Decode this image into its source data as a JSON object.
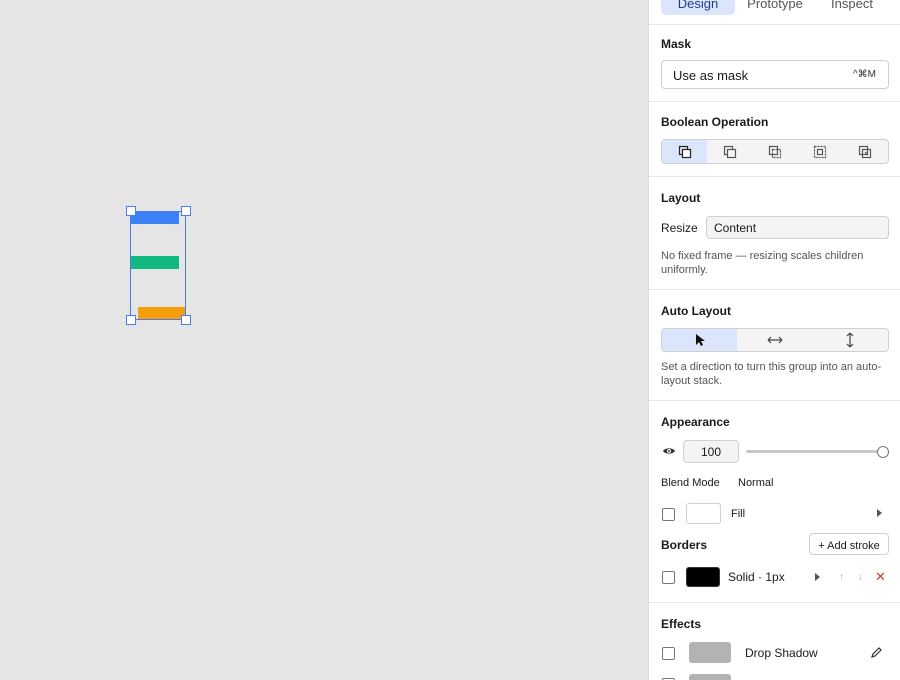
{
  "tabs": [
    "Design",
    "Prototype",
    "Inspect"
  ],
  "canvas": {
    "colors": {
      "bar1": "#3b82f6",
      "bar2": "#10b981",
      "bar3": "#f59e0b",
      "selection": "#4a7bf7"
    }
  },
  "mask": {
    "title": "Mask",
    "button_label": "Use as mask",
    "shortcut": "^⌘M"
  },
  "boolean": {
    "title": "Boolean Operation",
    "icons": [
      "union-icon",
      "subtract-icon",
      "intersect-icon",
      "exclude-icon",
      "flatten-icon"
    ]
  },
  "layout": {
    "title": "Layout",
    "resize_label": "Resize",
    "resize_value": "Content",
    "hint": "No fixed frame — resizing scales children uniformly."
  },
  "auto_layout": {
    "title": "Auto Layout",
    "options": [
      "pointer-icon",
      "horizontal-arrows-icon",
      "vertical-arrows-icon"
    ],
    "hint": "Set a direction to turn this group into an auto-layout stack."
  },
  "appearance": {
    "title": "Appearance",
    "opacity": "100",
    "opacity_percent": 100,
    "blend_label": "Blend Mode",
    "blend_value": "Normal",
    "fill_label": "Fill",
    "fill_color": "#ffffff"
  },
  "borders": {
    "title": "Borders",
    "add_label": "+ Add stroke",
    "stroke_label": "Solid · 1px",
    "stroke_color": "#000000"
  },
  "effects": {
    "title": "Effects",
    "items": [
      {
        "label": "Drop Shadow",
        "color": "#b3b3b3"
      },
      {
        "label": "",
        "color": "#b3b3b3"
      }
    ]
  }
}
